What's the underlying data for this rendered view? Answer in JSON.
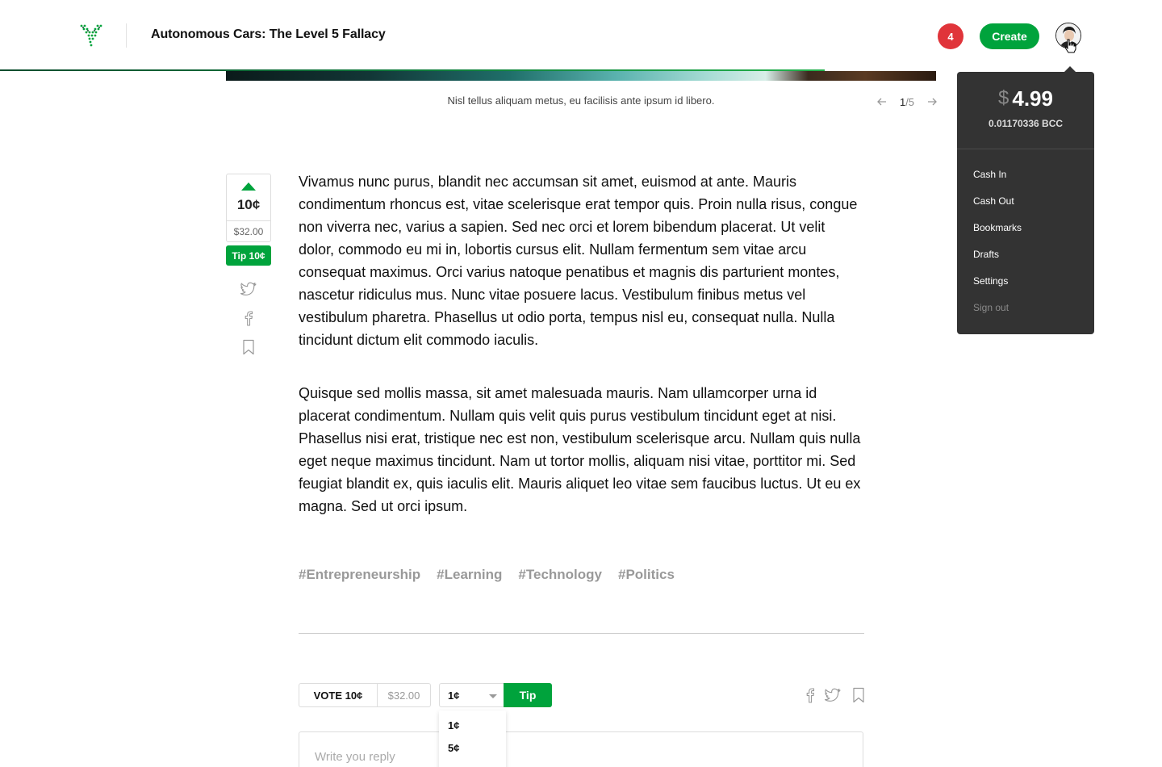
{
  "header": {
    "title": "Autonomous Cars: The Level 5 Fallacy",
    "notification_count": "4",
    "create_label": "Create",
    "read_progress": 0.71
  },
  "hero": {
    "caption": "Nisl tellus aliquam metus, eu facilisis ante ipsum id libero.",
    "pager_current": "1",
    "pager_total": "/5"
  },
  "vote_rail": {
    "amount": "10¢",
    "total": "$32.00",
    "tip_label": "Tip 10¢"
  },
  "article": {
    "paragraphs": [
      "Vivamus nunc purus, blandit nec accumsan sit amet, euismod at ante. Mauris condimentum rhoncus est, vitae scelerisque erat tempor quis. Proin nulla risus, congue non viverra nec, varius a sapien. Sed nec orci et lorem bibendum placerat. Ut velit dolor, commodo eu mi in, lobortis cursus elit. Nullam fermentum sem vitae arcu consequat maximus. Orci varius natoque penatibus et magnis dis parturient montes, nascetur ridiculus mus. Nunc vitae posuere lacus. Vestibulum finibus metus vel vestibulum pharetra. Phasellus ut odio porta, tempus nisl eu, consequat nulla. Nulla tincidunt dictum elit commodo iaculis.",
      "Quisque sed mollis massa, sit amet malesuada mauris. Nam ullamcorper urna id placerat condimentum. Nullam quis velit quis purus vestibulum tincidunt eget at nisi. Phasellus nisi erat, tristique nec est non, vestibulum scelerisque arcu. Nullam quis nulla eget neque maximus tincidunt. Nam ut tortor mollis, aliquam nisi vitae, porttitor mi. Sed feugiat blandit ex, quis iaculis elit. Mauris aliquet leo vitae sem faucibus luctus. Ut eu ex magna. Sed ut orci ipsum."
    ],
    "tags": [
      "#Entrepreneurship",
      "#Learning",
      "#Technology",
      "#Politics"
    ]
  },
  "action_bar": {
    "vote_label": "VOTE 10¢",
    "vote_total": "$32.00",
    "tip_selected": "1¢",
    "tip_label": "Tip",
    "tip_options": [
      "1¢",
      "5¢"
    ],
    "reply_placeholder": "Write you reply"
  },
  "account_menu": {
    "currency_symbol": "$",
    "balance": "4.99",
    "bcc_balance": "0.01170336 BCC",
    "items": [
      "Cash In",
      "Cash Out",
      "Bookmarks",
      "Drafts",
      "Settings",
      "Sign out"
    ]
  },
  "icons": {
    "logo": "logo-icon",
    "prev": "arrow-left-icon",
    "next": "arrow-right-icon",
    "upvote": "upvote-icon",
    "twitter": "twitter-icon",
    "facebook": "facebook-icon",
    "bookmark": "bookmark-icon",
    "caret": "caret-down-icon"
  },
  "colors": {
    "brand_green": "#00a33c",
    "badge_red": "#e0343a",
    "menu_bg": "#333333"
  }
}
